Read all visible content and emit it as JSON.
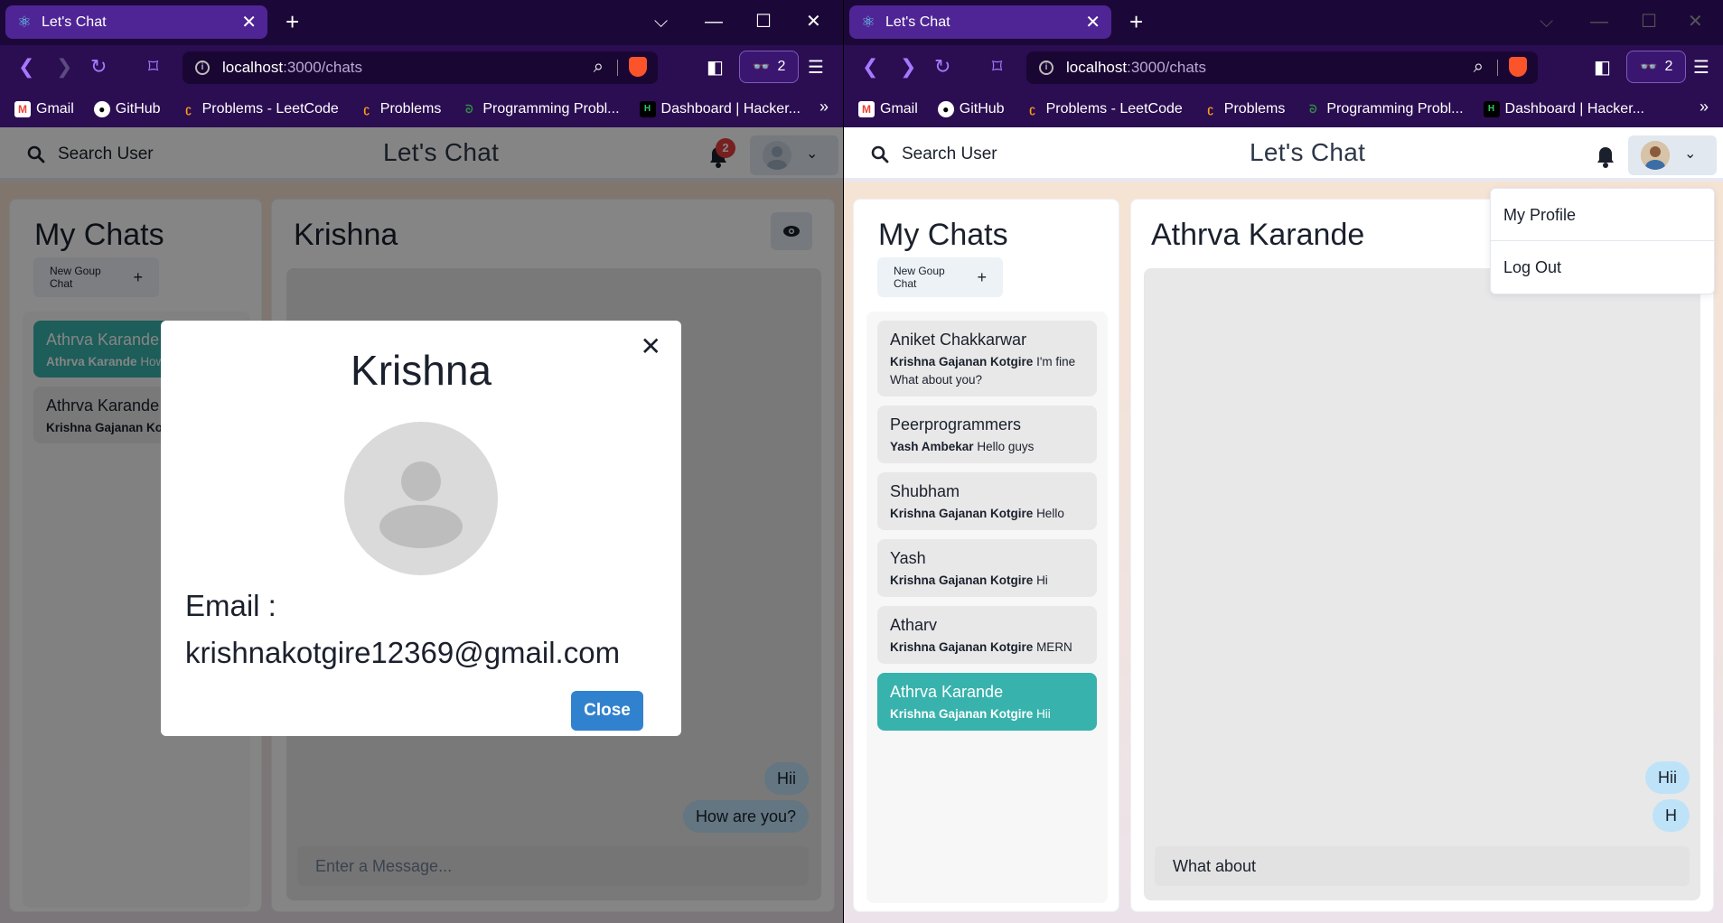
{
  "browser": {
    "tab_title": "Let's Chat",
    "url_host": "localhost",
    "url_path": ":3000/chats",
    "vpn_count": "2",
    "bookmarks": [
      "Gmail",
      "GitHub",
      "Problems - LeetCode",
      "Problems",
      "Programming Probl...",
      "Dashboard | Hacker..."
    ],
    "bookmarks_more": "»"
  },
  "app": {
    "search_label": "Search User",
    "title": "Let's Chat",
    "new_group_label": "New Goup Chat",
    "my_chats_heading": "My Chats",
    "message_placeholder": "Enter a Message..."
  },
  "left_window": {
    "notification_count": "2",
    "chat_header": "Krishna",
    "chats": [
      {
        "name": "Athrva Karande",
        "sender": "Athrva Karande",
        "text": "How are you?",
        "active": true
      },
      {
        "name": "Athrva Karande",
        "sender": "Krishna Gajanan Kotgire",
        "text": "",
        "active": false
      }
    ],
    "messages": [
      "Hii",
      "How are you?"
    ],
    "modal": {
      "title": "Krishna",
      "email_label": "Email :",
      "email": "krishnakotgire12369@gmail.com",
      "close_label": "Close"
    }
  },
  "right_window": {
    "chat_header": "Athrva Karande",
    "menu": [
      "My Profile",
      "Log Out"
    ],
    "chats": [
      {
        "name": "Aniket Chakkarwar",
        "sender": "Krishna Gajanan Kotgire",
        "text": "I'm fine What about you?"
      },
      {
        "name": "Peerprogrammers",
        "sender": "Yash Ambekar",
        "text": "Hello guys"
      },
      {
        "name": "Shubham",
        "sender": "Krishna Gajanan Kotgire",
        "text": "Hello"
      },
      {
        "name": "Yash",
        "sender": "Krishna Gajanan Kotgire",
        "text": "Hi"
      },
      {
        "name": "Atharv",
        "sender": "Krishna Gajanan Kotgire",
        "text": "MERN"
      },
      {
        "name": "Athrva Karande",
        "sender": "Krishna Gajanan Kotgire",
        "text": "Hii"
      }
    ],
    "messages": [
      "Hii",
      "H"
    ],
    "input_value": "What about"
  },
  "colors": {
    "browser_bg": "#2b0d52",
    "tab_active": "#4f2595",
    "active_chat": "#38b2ac",
    "bubble": "#bee3f8",
    "close_button": "#3182ce",
    "badge": "#e53e3e"
  }
}
